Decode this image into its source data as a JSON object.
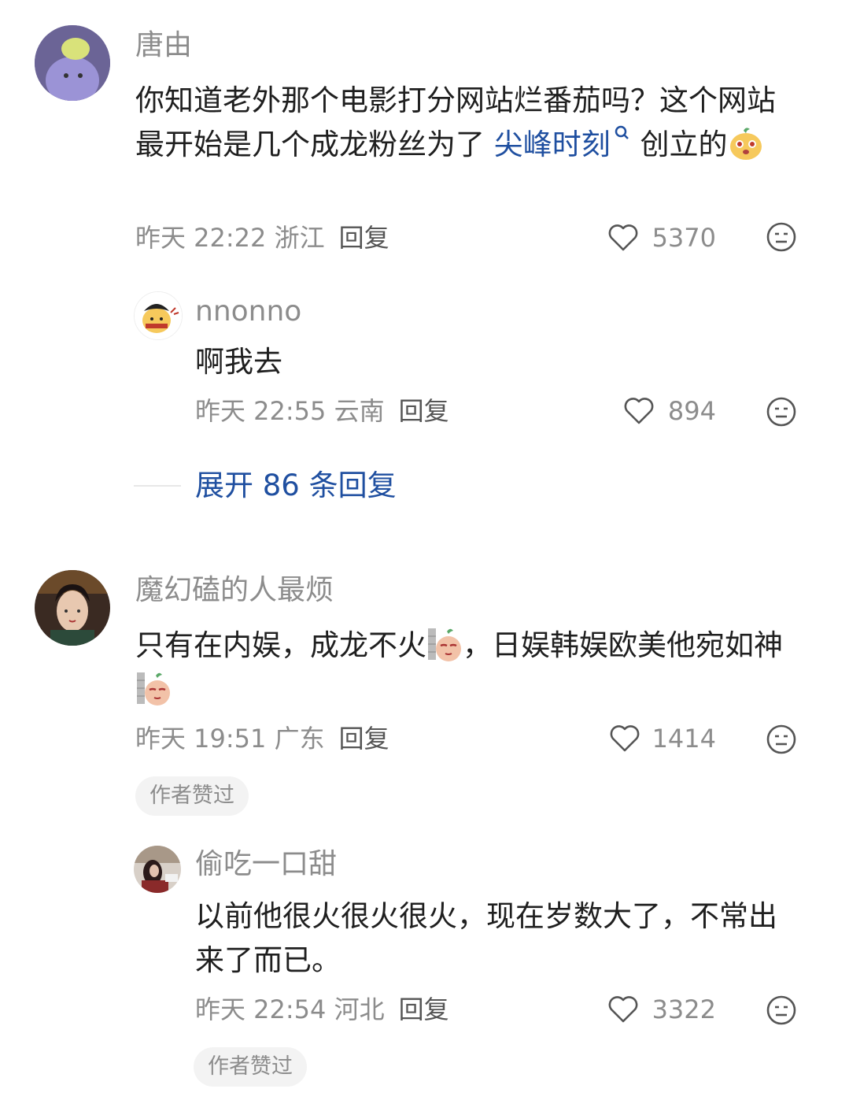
{
  "comments": [
    {
      "username": "唐由",
      "text_before": "你知道老外那个电影打分网站烂番茄吗？这个网站最开始是几个成龙粉丝为了 ",
      "link_text": "尖峰时刻",
      "text_after": " 创立的",
      "emoji": "cute-face-emoji",
      "time": "昨天 22:22 浙江",
      "reply_label": "回复",
      "likes": "5370",
      "replies": [
        {
          "username": "nnonno",
          "text": "啊我去",
          "time": "昨天 22:55 云南",
          "reply_label": "回复",
          "likes": "894"
        }
      ],
      "expand_label": "展开 86 条回复"
    },
    {
      "username": "魔幻磕的人最烦",
      "text_part1": "只有在内娱，成龙不火",
      "text_part2": "，日娱韩娱欧美他宛如神",
      "emoji": "peeking-wall-emoji",
      "time": "昨天 19:51 广东",
      "reply_label": "回复",
      "likes": "1414",
      "badge": "作者赞过",
      "replies": [
        {
          "username": "偷吃一口甜",
          "text": "以前他很火很火很火，现在岁数大了，不常出来了而已。",
          "time": "昨天 22:54 河北",
          "reply_label": "回复",
          "likes": "3322",
          "badge": "作者赞过"
        }
      ]
    }
  ],
  "colors": {
    "link": "#1f4fa0",
    "meta": "#8c8c8c"
  }
}
